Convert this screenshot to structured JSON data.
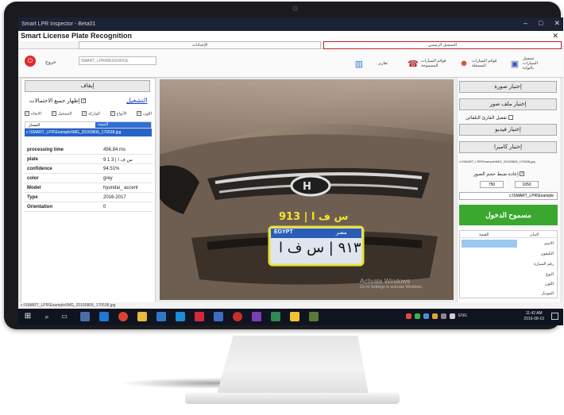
{
  "window": {
    "title": "Smart LPR Inspector - Beta01",
    "controls": [
      "–",
      "□",
      "✕"
    ]
  },
  "app": {
    "title": "Smart License Plate Recognition",
    "close": "✕"
  },
  "tabs": [
    {
      "label": "الإعدادات",
      "active": false
    },
    {
      "label": "التسجيل الرئيسي",
      "active": true
    }
  ],
  "ribbon": {
    "exit_label": "خروج",
    "path_placeholder": "SMART_LPR\\RESOURCE",
    "items": [
      {
        "label": "تقارير",
        "icon": "chart-icon"
      },
      {
        "label": "قوائم السيارات المسموحة",
        "icon": "car-phone-icon"
      },
      {
        "label": "قوائم السيارات المسجلة",
        "icon": "users-icon"
      },
      {
        "label": "تسجيل السيارات بالبوابة",
        "icon": "car-card-icon"
      }
    ]
  },
  "left": {
    "stop_button": "إيقاف",
    "show_all_label": "إظهار جميع الاحتمالات",
    "tasks_label": "التشغيل",
    "filters": [
      "اللون",
      "الأنواع",
      "الماركة",
      "التسجيل",
      "الاتجاه"
    ],
    "list_headers": {
      "left": "المسار",
      "right": "النتيجة"
    },
    "selected_path": "c:\\SMART_LPR\\Example\\IMG_20160806_170538.jpg",
    "rows": [
      {
        "key": "processing time",
        "value": "456.84 ms"
      },
      {
        "key": "plate",
        "value": "9 1 3 | س ف ا"
      },
      {
        "key": "confidence",
        "value": "94.51%"
      },
      {
        "key": "color",
        "value": "grey"
      },
      {
        "key": "Model",
        "value": "hyundai_ accent"
      },
      {
        "key": "Type",
        "value": "2016-2017"
      },
      {
        "key": "Orientation",
        "value": "0"
      }
    ]
  },
  "image": {
    "overlay_text": "913 | س ف ا",
    "plate_country": "EGYPT",
    "plate_country_ar": "مصر",
    "plate_text": "٩١٣ | س ف ا",
    "watermark_title": "Activate Windows",
    "watermark_sub": "Go to Settings to activate Windows."
  },
  "right": {
    "btn_image": "إختيار صورة",
    "btn_folder": "إختيار ملف صور",
    "auto_read": "تفعيل القارئ التلقائي",
    "btn_video": "إختيار فيديو",
    "btn_camera": "إختيار كاميرا",
    "selected_file": "c:\\SMART_LPR\\Example\\IMG_20160806_170538.jpg",
    "resize_label": "إعادة ضبط حجم الصور",
    "width": "750",
    "height": "1050",
    "folder_path": "c:\\SMART_LPR\\Example",
    "allow_entry": "مسموح الدخول",
    "table_headers": {
      "left": "القيمة",
      "right": "البيان"
    },
    "table_rows": [
      "الاسم",
      "التليفون",
      "رقم السيارة",
      "النوع",
      "اللون",
      "الموديل"
    ]
  },
  "status_path": "c:\\SMART_LPR\\Example\\IMG_20160806_170538.jpg",
  "taskbar": {
    "time": "11:42 AM",
    "date": "2016-08-10",
    "lang": "ENG"
  }
}
